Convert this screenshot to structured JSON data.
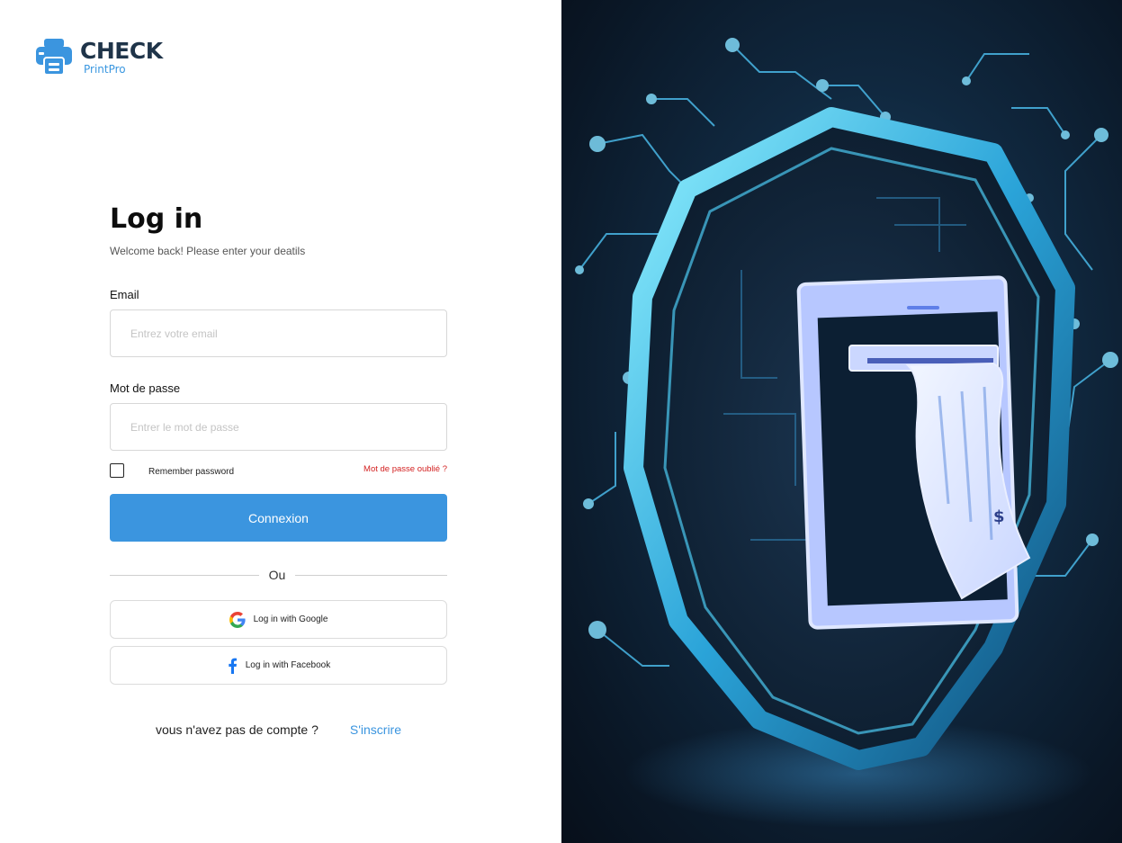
{
  "logo": {
    "title": "CHECK",
    "subtitle": "PrintPro",
    "icon": "printer-icon"
  },
  "login": {
    "title": "Log in",
    "subtitle": "Welcome back! Please enter your deatils",
    "email": {
      "label": "Email",
      "placeholder": "Entrez votre email",
      "value": ""
    },
    "password": {
      "label": "Mot de passe",
      "placeholder": "Entrer le mot de passe",
      "value": ""
    },
    "remember_label": "Remember password",
    "remember_checked": false,
    "forgot_label": "Mot de passe oublié ?",
    "submit_label": "Connexion",
    "divider_text": "Ou",
    "google_label": "Log in with Google",
    "facebook_label": "Log in with Facebook",
    "signup_question": "vous n'avez pas de compte ?",
    "signup_link": "S'inscrire"
  },
  "colors": {
    "primary": "#3b95df",
    "logo_dark": "#1f3449",
    "forgot": "#d32222"
  },
  "illustration": {
    "icon": "shield-check-printer-illustration"
  }
}
